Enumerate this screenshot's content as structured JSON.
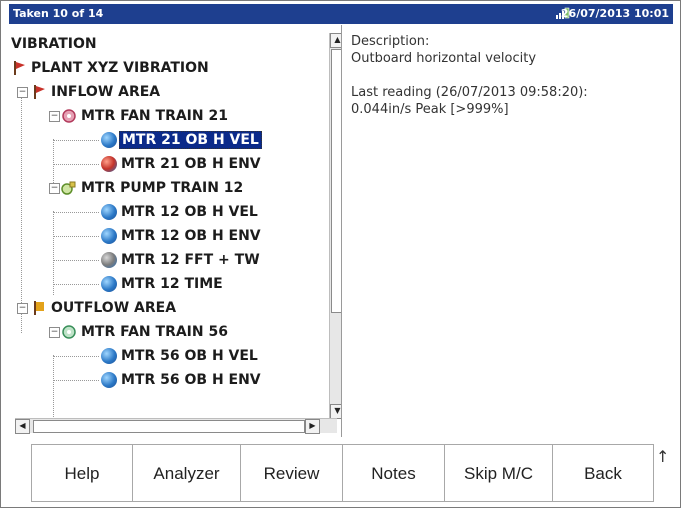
{
  "titlebar": {
    "left": "Taken 10 of 14",
    "right": "26/07/2013 10:01"
  },
  "tree": {
    "items": [
      {
        "label": "VIBRATION",
        "icon": "none"
      },
      {
        "label": "PLANT XYZ VIBRATION",
        "icon": "red-flag-icon"
      },
      {
        "label": "INFLOW AREA",
        "icon": "red-flag-icon"
      },
      {
        "label": "MTR FAN TRAIN 21",
        "icon": "fan-machine-icon"
      },
      {
        "label": "MTR 21 OB H VEL",
        "icon": "globe-icon",
        "selected": true
      },
      {
        "label": "MTR 21 OB H ENV",
        "icon": "globe-env-icon"
      },
      {
        "label": "MTR PUMP TRAIN 12",
        "icon": "pump-machine-icon"
      },
      {
        "label": "MTR 12 OB H VEL",
        "icon": "globe-icon"
      },
      {
        "label": "MTR 12 OB H ENV",
        "icon": "globe-icon"
      },
      {
        "label": "MTR 12 FFT + TW",
        "icon": "globe-fft-icon"
      },
      {
        "label": "MTR 12 TIME",
        "icon": "globe-icon"
      },
      {
        "label": "OUTFLOW AREA",
        "icon": "orange-flag-icon"
      },
      {
        "label": "MTR FAN TRAIN 56",
        "icon": "fan-machine-icon"
      },
      {
        "label": "MTR 56 OB H VEL",
        "icon": "globe-icon"
      },
      {
        "label": "MTR 56 OB H ENV",
        "icon": "globe-icon"
      }
    ]
  },
  "detail": {
    "desc_label": "Description:",
    "desc_value": "Outboard horizontal velocity",
    "reading_label": "Last reading (26/07/2013 09:58:20):",
    "reading_value": "0.044in/s Peak [>999%]"
  },
  "buttons": {
    "help": "Help",
    "analyzer": "Analyzer",
    "review": "Review",
    "notes": "Notes",
    "skip": "Skip M/C",
    "back": "Back"
  },
  "colors": {
    "titlebar": "#1e3f8f",
    "selection": "#0b2a8a"
  }
}
